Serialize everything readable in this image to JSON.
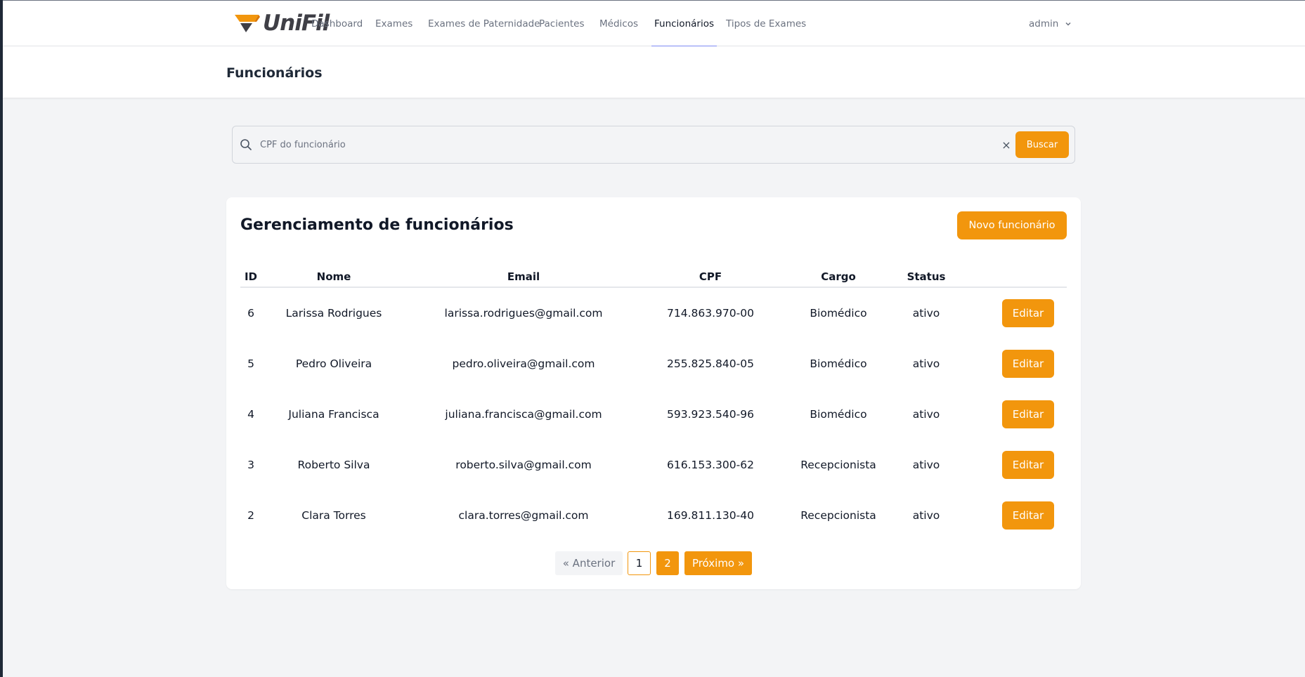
{
  "brand": {
    "name": "UniFil",
    "accent": "#f2960d",
    "text_color": "#3f3f46"
  },
  "nav": {
    "links": [
      {
        "label": "Dashboard"
      },
      {
        "label": "Exames"
      },
      {
        "label": "Exames de Paternidade"
      },
      {
        "label": "Pacientes"
      },
      {
        "label": "Médicos"
      },
      {
        "label": "Funcionários",
        "active": true
      },
      {
        "label": "Tipos de Exames"
      }
    ],
    "active_underline_color": "#818cf8",
    "user": {
      "label": "admin",
      "icon": "chevron-down-icon"
    }
  },
  "page": {
    "title": "Funcionários"
  },
  "search": {
    "placeholder": "CPF do funcionário",
    "value": "",
    "icon": "search-icon",
    "clear_label": "×",
    "button_label": "Buscar"
  },
  "card": {
    "title": "Gerenciamento de funcionários",
    "new_button_label": "Novo funcionário"
  },
  "table": {
    "headers": {
      "id": "ID",
      "nome": "Nome",
      "email": "Email",
      "cpf": "CPF",
      "cargo": "Cargo",
      "status": "Status"
    },
    "rows": [
      {
        "id": "6",
        "nome": "Larissa Rodrigues",
        "email": "larissa.rodrigues@gmail.com",
        "cpf": "714.863.970-00",
        "cargo": "Biomédico",
        "status": "ativo",
        "action": "Editar"
      },
      {
        "id": "5",
        "nome": "Pedro Oliveira",
        "email": "pedro.oliveira@gmail.com",
        "cpf": "255.825.840-05",
        "cargo": "Biomédico",
        "status": "ativo",
        "action": "Editar"
      },
      {
        "id": "4",
        "nome": "Juliana Francisca",
        "email": "juliana.francisca@gmail.com",
        "cpf": "593.923.540-96",
        "cargo": "Biomédico",
        "status": "ativo",
        "action": "Editar"
      },
      {
        "id": "3",
        "nome": "Roberto Silva",
        "email": "roberto.silva@gmail.com",
        "cpf": "616.153.300-62",
        "cargo": "Recepcionista",
        "status": "ativo",
        "action": "Editar"
      },
      {
        "id": "2",
        "nome": "Clara Torres",
        "email": "clara.torres@gmail.com",
        "cpf": "169.811.130-40",
        "cargo": "Recepcionista",
        "status": "ativo",
        "action": "Editar"
      }
    ]
  },
  "pagination": {
    "prev_label": "« Anterior",
    "pages": [
      "1",
      "2"
    ],
    "current_page": "2",
    "next_label": "Próximo »"
  }
}
